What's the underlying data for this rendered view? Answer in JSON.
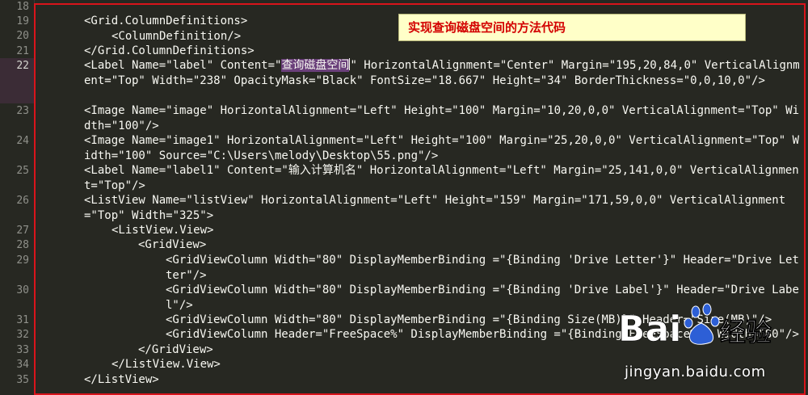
{
  "editor": {
    "lines": [
      {
        "num": "18",
        "indent": "",
        "text": ""
      },
      {
        "num": "19",
        "indent": "    ",
        "text": "<Grid.ColumnDefinitions>"
      },
      {
        "num": "20",
        "indent": "        ",
        "text": "<ColumnDefinition/>"
      },
      {
        "num": "21",
        "indent": "    ",
        "text": "</Grid.ColumnDefinitions>"
      },
      {
        "num": "22",
        "indent": "    ",
        "pre": "<Label Name=\"label\" Content=\"",
        "highlight": "查询磁盘空间",
        "post": "\" HorizontalAlignment=\"Center\" Margin=\"195,20,84,0\" VerticalAlignment=\"Top\" Width=\"238\" OpacityMask=\"Black\" FontSize=\"18.667\" Height=\"34\" BorderThickness=\"0,0,10,0\"/>"
      },
      {
        "num": "23",
        "indent": "    ",
        "text": "<Image Name=\"image\" HorizontalAlignment=\"Left\" Height=\"100\" Margin=\"10,20,0,0\" VerticalAlignment=\"Top\" Width=\"100\"/>"
      },
      {
        "num": "24",
        "indent": "    ",
        "text": "<Image Name=\"image1\" HorizontalAlignment=\"Left\" Height=\"100\" Margin=\"25,20,0,0\" VerticalAlignment=\"Top\" Width=\"100\" Source=\"C:\\Users\\melody\\Desktop\\55.png\"/>"
      },
      {
        "num": "25",
        "indent": "    ",
        "text": "<Label Name=\"label1\" Content=\"输入计算机名\" HorizontalAlignment=\"Left\" Margin=\"25,141,0,0\" VerticalAlignment=\"Top\"/>"
      },
      {
        "num": "26",
        "indent": "    ",
        "text": "<ListView Name=\"listView\" HorizontalAlignment=\"Left\" Height=\"159\" Margin=\"171,59,0,0\" VerticalAlignment=\"Top\" Width=\"325\">"
      },
      {
        "num": "27",
        "indent": "        ",
        "text": "<ListView.View>"
      },
      {
        "num": "28",
        "indent": "            ",
        "text": "<GridView>"
      },
      {
        "num": "29",
        "indent": "                ",
        "text": "<GridViewColumn Width=\"80\" DisplayMemberBinding =\"{Binding 'Drive Letter'}\" Header=\"Drive Letter\"/>"
      },
      {
        "num": "30",
        "indent": "                ",
        "text": "<GridViewColumn Width=\"80\" DisplayMemberBinding =\"{Binding 'Drive Label'}\" Header=\"Drive Label\"/>"
      },
      {
        "num": "31",
        "indent": "                ",
        "text": "<GridViewColumn Width=\"80\" DisplayMemberBinding =\"{Binding Size(MB)}\" Header=\"Size(MB)\"/>"
      },
      {
        "num": "32",
        "indent": "                ",
        "text": "<GridViewColumn Header=\"FreeSpace%\" DisplayMemberBinding =\"{Binding FreeSpace%}\" Width=\"80\"/>"
      },
      {
        "num": "33",
        "indent": "            ",
        "text": "</GridView>"
      },
      {
        "num": "34",
        "indent": "        ",
        "text": "</ListView.View>"
      },
      {
        "num": "35",
        "indent": "    ",
        "text": "</ListView>"
      }
    ]
  },
  "callout": {
    "text": "实现查询磁盘空间的方法代码"
  },
  "watermark": {
    "brand": "Baidu经验",
    "url": "jingyan.baidu.com"
  },
  "colors": {
    "background": "#272822",
    "frame": "#d9141b",
    "highlight": "#6a3f7a",
    "callout_bg": "#ffffc8",
    "callout_text": "#d30000"
  }
}
